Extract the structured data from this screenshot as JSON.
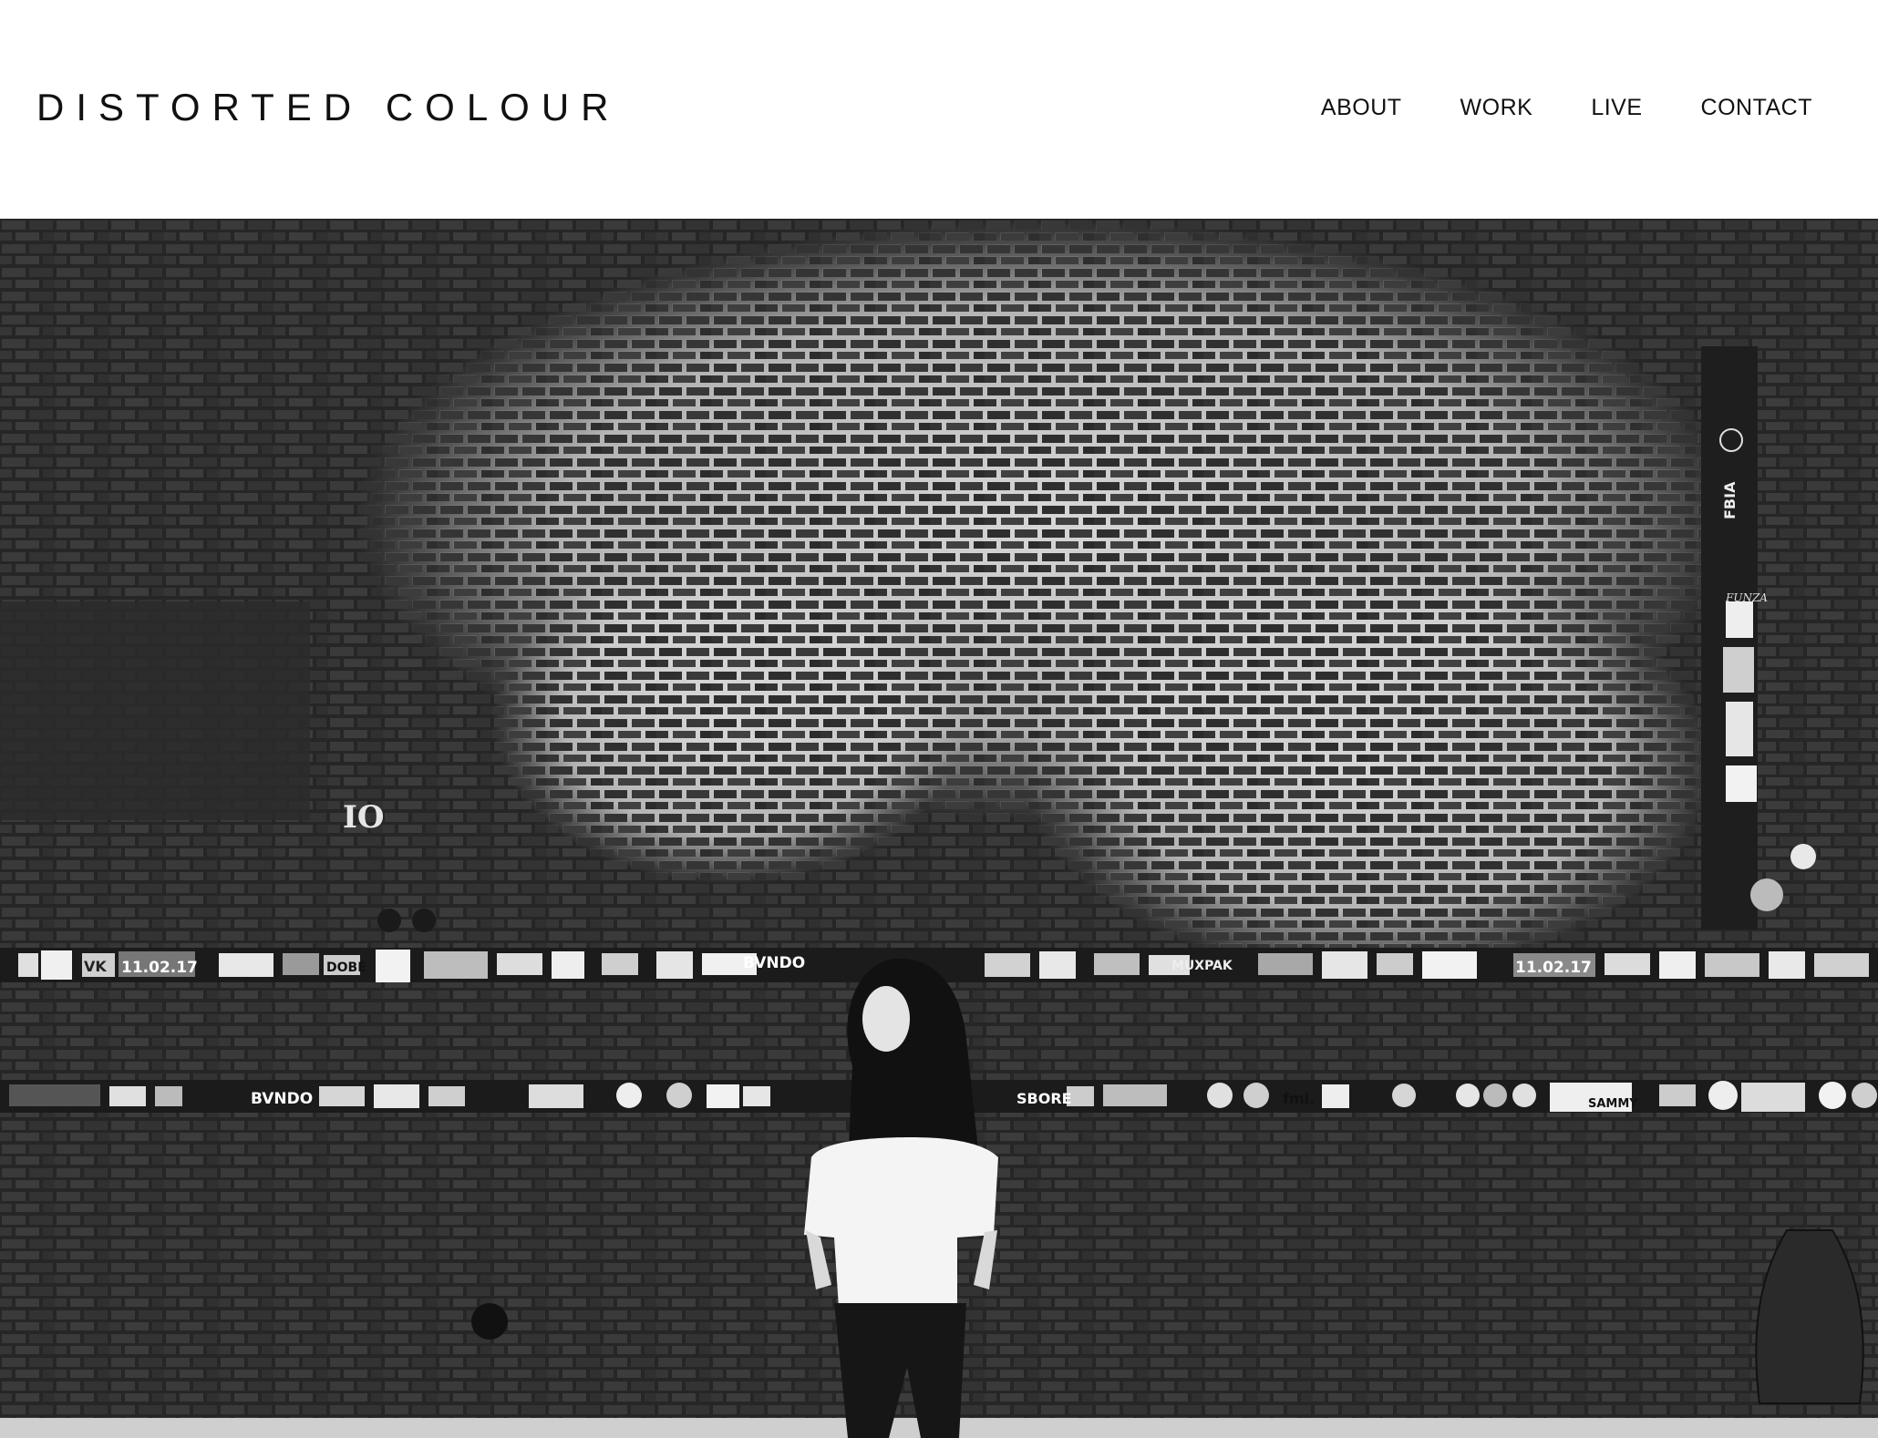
{
  "site": {
    "logo": "DISTORTED COLOUR"
  },
  "nav": {
    "items": [
      {
        "label": "ABOUT"
      },
      {
        "label": "WORK"
      },
      {
        "label": "LIVE"
      },
      {
        "label": "CONTACT"
      }
    ]
  },
  "hero": {
    "wall_text": {
      "io": "IO",
      "date_left": "11.02.17",
      "date_right": "11.02.17",
      "bvndo_top": "BVNDO",
      "bvndo_bottom": "BVNDO",
      "vk": "VK",
      "dobe": "DOBE",
      "muxpak": "MUXPAK",
      "sbore": "SBORE",
      "fml": "fml.",
      "sammy": "SAMMY",
      "fbia": "FBIA",
      "funza": "FUNZA"
    }
  }
}
